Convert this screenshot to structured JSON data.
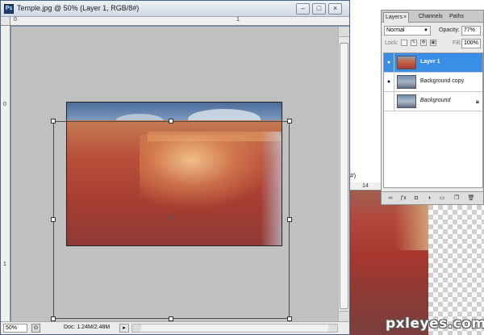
{
  "document": {
    "title": "Temple.jpg @ 50% (Layer 1, RGB/8#)",
    "app_icon_label": "Ps",
    "ruler_top_numbers": [
      "0",
      "1"
    ],
    "ruler_left_numbers": [
      "0",
      "1"
    ],
    "status": {
      "zoom": "50%",
      "doc_info": "Doc: 1.24M/2.48M"
    }
  },
  "second_document": {
    "title_fragment": "#)",
    "ruler_number": "14"
  },
  "layers_panel": {
    "tabs": [
      {
        "label": "Layers",
        "active": true
      },
      {
        "label": "Channels",
        "active": false
      },
      {
        "label": "Paths",
        "active": false
      }
    ],
    "tab_close": "×",
    "blend_mode": "Normal",
    "opacity_label": "Opacity:",
    "opacity_value": "77%",
    "lock_label": "Lock:",
    "fill_label": "Fill:",
    "fill_value": "100%",
    "layers": [
      {
        "name": "Layer 1",
        "visible": true,
        "selected": true,
        "locked": false
      },
      {
        "name": "Background copy",
        "visible": true,
        "selected": false,
        "locked": false
      },
      {
        "name": "Background",
        "visible": false,
        "selected": false,
        "locked": true
      }
    ],
    "footer_icons": [
      "link-icon",
      "fx-icon",
      "mask-icon",
      "adjustment-icon",
      "folder-icon",
      "new-layer-icon",
      "trash-icon"
    ]
  },
  "watermark": "pxleyes.com",
  "colors": {
    "selection": "#3a8ee6",
    "canvas_gray": "#c0c0c0",
    "rock_red": "#a63d31"
  }
}
